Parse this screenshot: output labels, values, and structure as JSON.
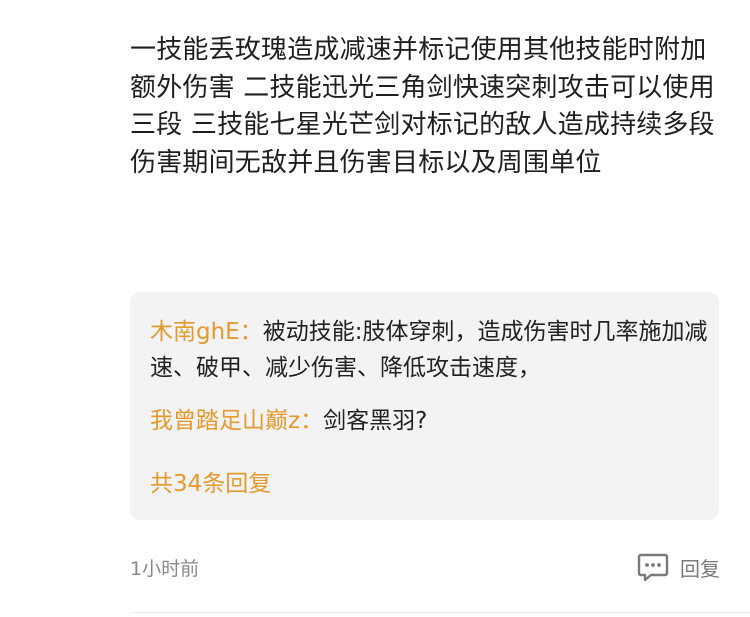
{
  "comment": {
    "text": "一技能丢玫瑰造成减速并标记使用其他技能时附加额外伤害 二技能迅光三角剑快速突刺攻击可以使用三段 三技能七星光芒剑对标记的敌人造成持续多段伤害期间无敌并且伤害目标以及周围单位",
    "timestamp": "1小时前",
    "reply_label": "回复",
    "icon": "comment-bubble-icon"
  },
  "replies": [
    {
      "author": "木南ghE：",
      "text": "被动技能:肢体穿刺，造成伤害时几率施加减速、破甲、减少伤害、降低攻击速度，"
    },
    {
      "author": "我曾踏足山巅z：",
      "text": "剑客黑羽?"
    }
  ],
  "replies_summary": {
    "label": "共34条回复"
  },
  "colors": {
    "author": "#e59a2b",
    "panel_bg": "#f3f3f5",
    "muted": "#8a8a8a",
    "body_text": "#1f1f1f"
  }
}
